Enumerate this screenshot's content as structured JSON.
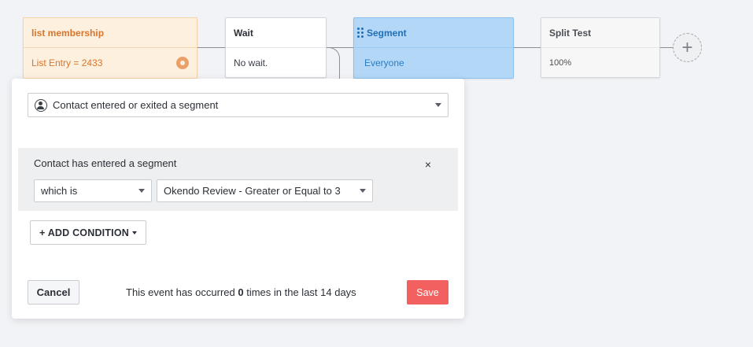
{
  "flow": {
    "trigger": {
      "title": "list membership",
      "detail": "List Entry = 2433",
      "icon": "gear-icon"
    },
    "wait": {
      "title": "Wait",
      "detail": "No wait."
    },
    "segment": {
      "title": "Segment",
      "detail": "Everyone",
      "icon": "drag-handle-icon"
    },
    "split": {
      "title": "Split Test",
      "detail": "100%"
    },
    "add_node": {
      "label": "+",
      "icon": "plus-icon"
    }
  },
  "editor": {
    "event_select": {
      "value": "Contact entered or exited a segment",
      "icon": "contact-icon"
    },
    "condition": {
      "title": "Contact has entered a segment",
      "close_label": "×",
      "operator": "which is",
      "segment": "Okendo Review - Greater or Equal to 3"
    },
    "add_condition_label": "+ ADD CONDITION",
    "cancel_label": "Cancel",
    "save_label": "Save",
    "occurrence": {
      "prefix": "This event has occurred",
      "count": "0",
      "suffix": "times in the last 14 days"
    }
  },
  "colors": {
    "trigger_bg": "#fdf0df",
    "trigger_text": "#d9752a",
    "segment_bg": "#b3d7f7",
    "segment_text": "#1f6fb7",
    "save_bg": "#f2605f",
    "canvas_bg": "#f1f3f6"
  }
}
